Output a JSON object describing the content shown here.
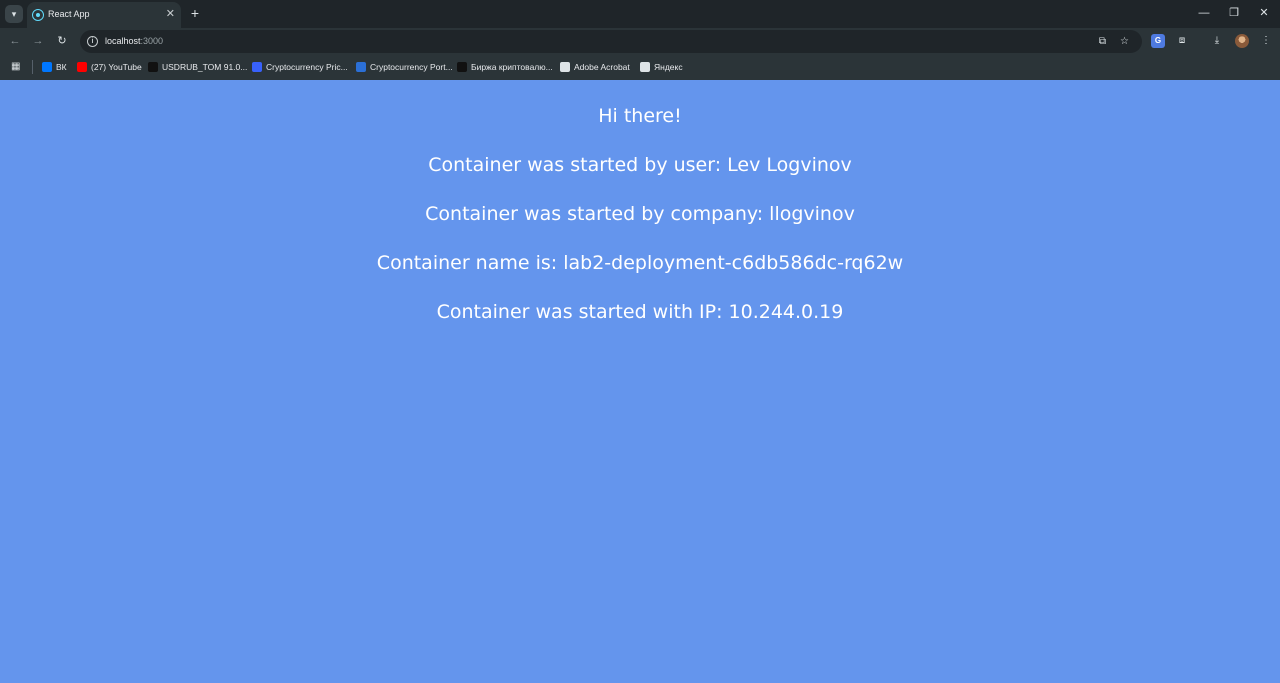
{
  "browser": {
    "tab": {
      "title": "React App",
      "close": "✕"
    },
    "new_tab": "+",
    "window": {
      "minimize": "—",
      "restore": "❐",
      "close": "✕"
    },
    "address": {
      "host": "localhost",
      "port": ":3000"
    },
    "bookmarks": [
      {
        "label": "ВК",
        "icon": "vk-icon",
        "color": "#0077ff"
      },
      {
        "label": "(27) YouTube",
        "icon": "youtube-icon",
        "color": "#ff0000"
      },
      {
        "label": "USDRUB_TOM 91.0...",
        "icon": "tradingview-icon",
        "color": "#111111"
      },
      {
        "label": "Cryptocurrency Pric...",
        "icon": "coinmarketcap-icon",
        "color": "#3861fb"
      },
      {
        "label": "Cryptocurrency Port...",
        "icon": "drop-icon",
        "color": "#2b6fd6"
      },
      {
        "label": "Биржа криптовалю...",
        "icon": "exchange-icon",
        "color": "#111111"
      },
      {
        "label": "Adobe Acrobat",
        "icon": "globe-icon",
        "color": "#dde3e6"
      },
      {
        "label": "Яндекс",
        "icon": "globe-icon",
        "color": "#dde3e6"
      }
    ]
  },
  "page": {
    "background": "#6495ED",
    "lines": [
      "Hi there!",
      "Container was started by user: Lev Logvinov",
      "Container was started by company: llogvinov",
      "Container name is: lab2-deployment-c6db586dc-rq62w",
      "Container was started with IP: 10.244.0.19"
    ]
  }
}
